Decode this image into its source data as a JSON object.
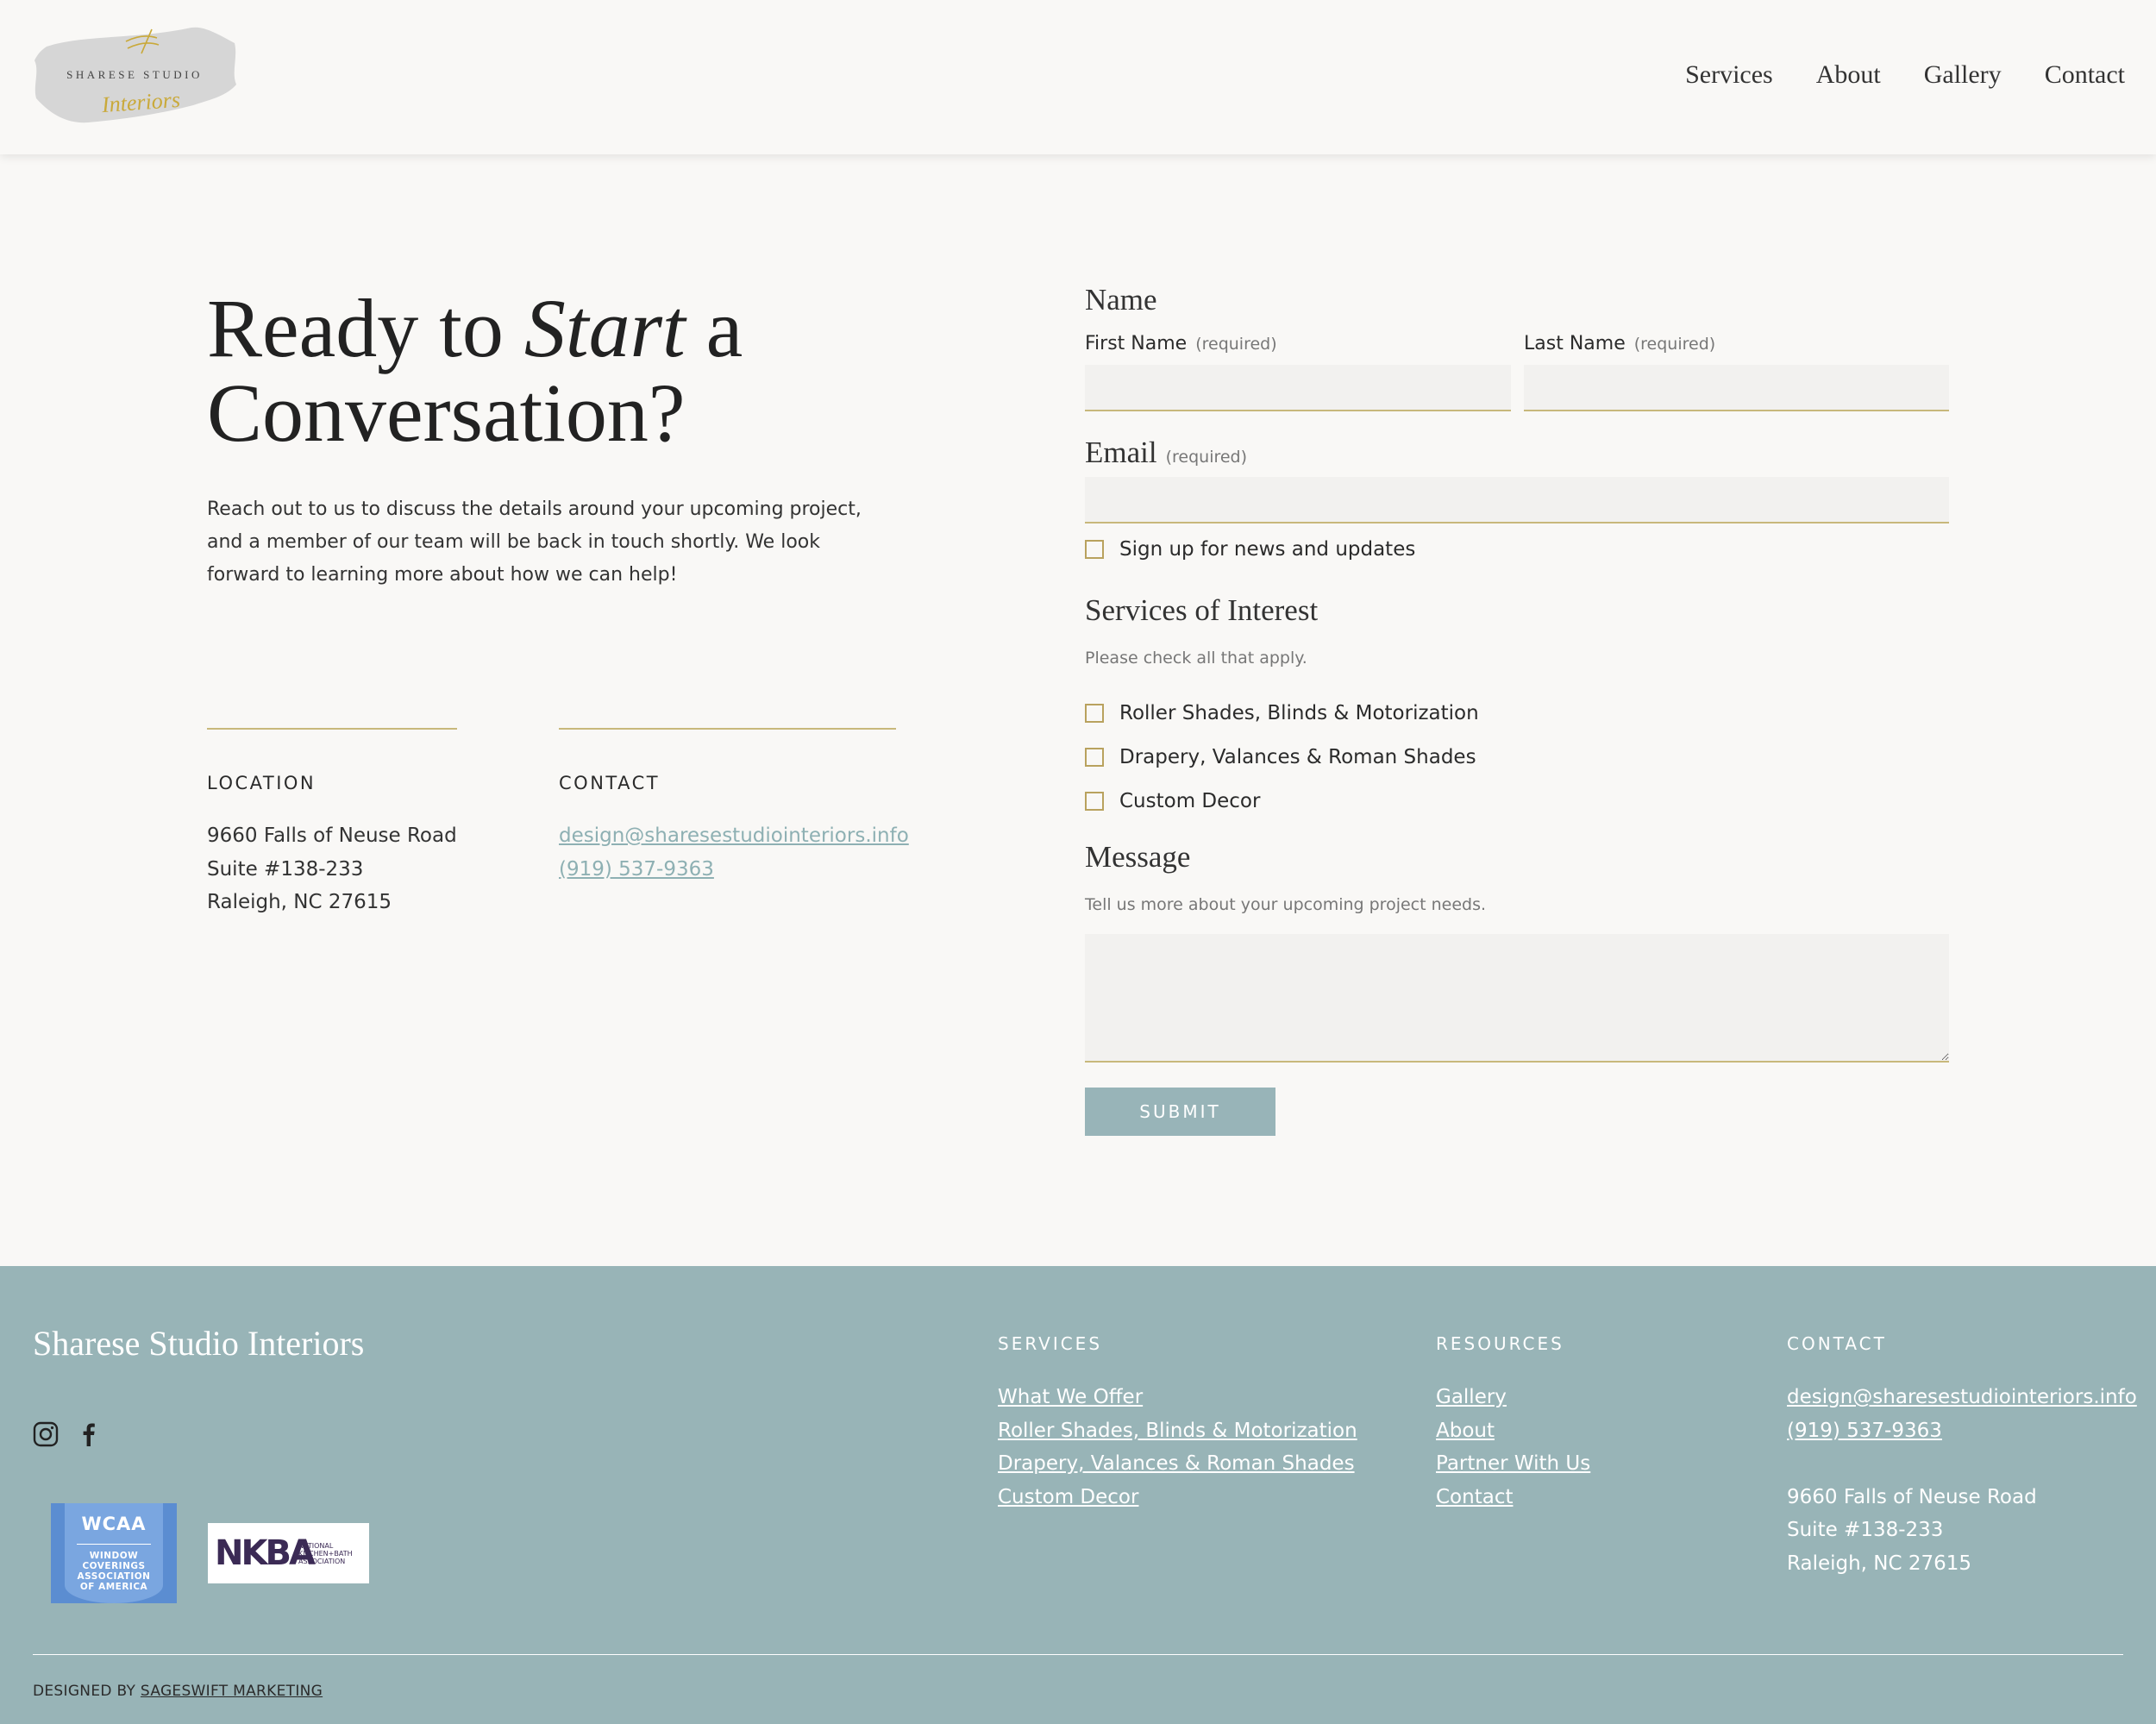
{
  "header": {
    "logo": {
      "top_text": "SHARESE STUDIO",
      "script_text": "Interiors"
    },
    "nav": [
      {
        "label": "Services"
      },
      {
        "label": "About"
      },
      {
        "label": "Gallery"
      },
      {
        "label": "Contact"
      }
    ]
  },
  "hero": {
    "title_part1": "Ready to",
    "title_italic": "Start",
    "title_part2": "a",
    "title_line2": "Conversation?",
    "body": "Reach out to us to discuss the details around your upcoming project, and a member of our team will be back in touch shortly. We look forward to learning more about how we can help!"
  },
  "location": {
    "heading": "LOCATION",
    "lines": [
      "9660 Falls of Neuse Road",
      "Suite #138-233",
      "Raleigh, NC 27615"
    ]
  },
  "contact": {
    "heading": "CONTACT",
    "email": "design@sharesestudiointeriors.info",
    "phone": "(919) 537-9363"
  },
  "form": {
    "name_title": "Name",
    "first_name_label": "First Name",
    "last_name_label": "Last Name",
    "required_text": "(required)",
    "email_title": "Email",
    "newsletter_label": "Sign up for news and updates",
    "services_title": "Services of Interest",
    "services_hint": "Please check all that apply.",
    "services": [
      {
        "label": "Roller Shades, Blinds & Motorization"
      },
      {
        "label": "Drapery, Valances & Roman Shades"
      },
      {
        "label": "Custom Decor"
      }
    ],
    "message_title": "Message",
    "message_hint": "Tell us more about your upcoming project needs.",
    "submit_label": "SUBMIT"
  },
  "footer": {
    "brand": "Sharese Studio Interiors",
    "social": [
      {
        "icon": "instagram-icon"
      },
      {
        "icon": "facebook-icon"
      }
    ],
    "badges": {
      "wcaa_title": "WCAA",
      "wcaa_lines": [
        "WINDOW",
        "COVERINGS",
        "ASSOCIATION",
        "OF AMERICA"
      ],
      "nkba_mark": "NKBA",
      "nkba_lines": [
        "NATIONAL",
        "KITCHEN+BATH",
        "ASSOCIATION"
      ]
    },
    "services_heading": "SERVICES",
    "services_links": [
      "What We Offer",
      "Roller Shades, Blinds & Motorization",
      "Drapery, Valances & Roman Shades",
      "Custom Decor"
    ],
    "resources_heading": "RESOURCES",
    "resources_links": [
      "Gallery",
      "About",
      "Partner With Us",
      "Contact"
    ],
    "contact_heading": "CONTACT",
    "contact_email": "design@sharesestudiointeriors.info",
    "contact_phone": "(919) 537-9363",
    "address_lines": [
      "9660 Falls of Neuse Road",
      "Suite #138-233",
      "Raleigh, NC 27615"
    ],
    "credit_prefix": "DESIGNED BY",
    "credit_link": "SAGESWIFT MARKETING"
  },
  "colors": {
    "accent_gold": "#c8b87b",
    "footer_teal": "#98b4b7",
    "link_teal": "#8eb0b3",
    "page_bg": "#f9f8f6"
  }
}
